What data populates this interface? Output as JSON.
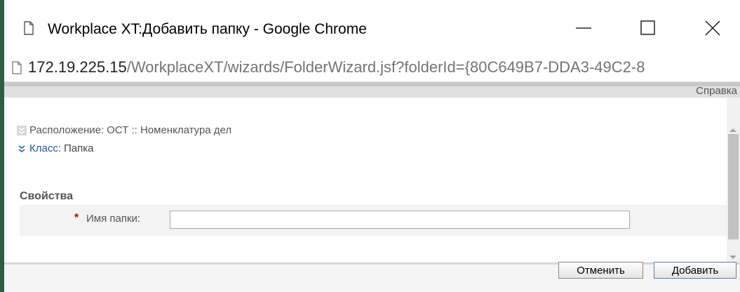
{
  "window": {
    "title": "Workplace XT:Добавить папку - Google Chrome"
  },
  "address": {
    "host": "172.19.225.15",
    "path": "/WorkplaceXT/wizards/FolderWizard.jsf?folderId={80C649B7-DDA3-49C2-8"
  },
  "menu": {
    "help": "Справка"
  },
  "location": {
    "label": "Расположение:",
    "value": "ОСТ :: Номенклатура дел"
  },
  "class": {
    "label": "Класс:",
    "value": "Папка"
  },
  "properties": {
    "title": "Свойства",
    "required_mark": "*",
    "folder_name_label": "Имя папки:",
    "folder_name_value": ""
  },
  "buttons": {
    "cancel": "Отменить",
    "add": "Добавить"
  },
  "icons": {
    "document": "document-icon",
    "minimize": "minimize-icon",
    "maximize": "maximize-icon",
    "close": "close-icon",
    "chevron": "chevron-down-icon"
  },
  "colors": {
    "link_blue": "#1f5a9c",
    "required_red": "#c00000"
  }
}
